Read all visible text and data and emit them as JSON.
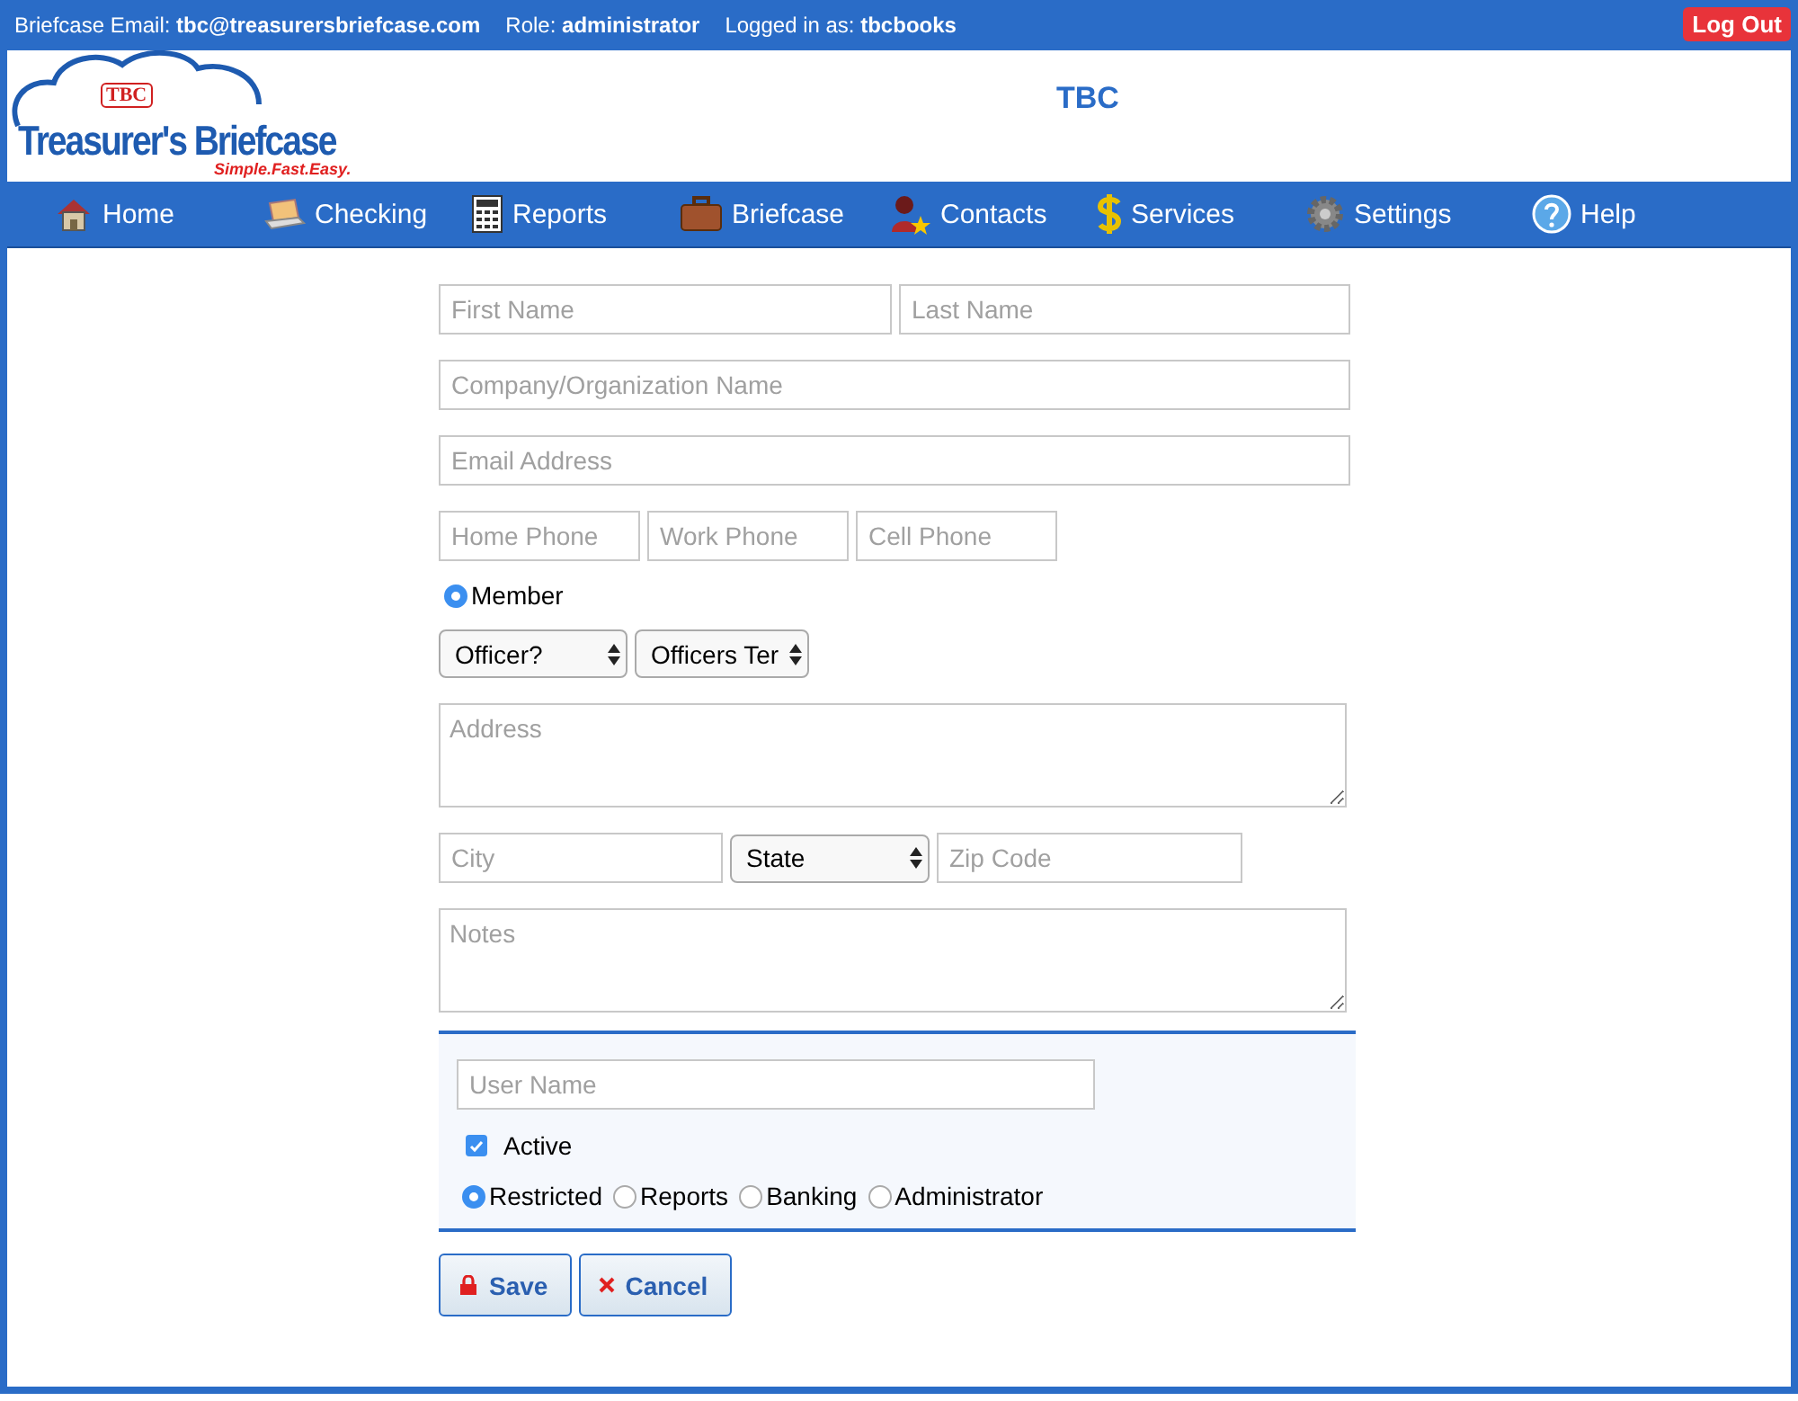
{
  "top_bar": {
    "items": [
      "Briefcase Email: **tbc@treasurersbriefcase.com**",
      "Role: **administrator**",
      "Logged in as: **tbcbooks**"
    ],
    "logout": "Log Out"
  },
  "header": {
    "logo": {
      "badge": "TBC",
      "name": "Treasurer's Briefcase",
      "tagline": "Simple.Fast.Easy."
    },
    "title": "TBC"
  },
  "nav": [
    {
      "label": "Home",
      "kind": "home"
    },
    {
      "label": "Checking",
      "kind": "checking"
    },
    {
      "label": "Reports",
      "kind": "reports"
    },
    {
      "label": "Briefcase",
      "kind": "briefcase"
    },
    {
      "label": "Contacts",
      "kind": "contacts"
    },
    {
      "label": "Services",
      "kind": "services"
    },
    {
      "label": "Settings",
      "kind": "settings"
    },
    {
      "label": "Help",
      "kind": "help"
    }
  ],
  "form": {
    "fields": [
      {
        "kind": "input",
        "placeholder": "First Name"
      },
      {
        "kind": "input",
        "placeholder": "Last Name"
      },
      {
        "kind": "input",
        "placeholder": "Company/Organization Name"
      },
      {
        "kind": "input",
        "placeholder": "Email Address"
      },
      {
        "kind": "input",
        "placeholder": "Home Phone"
      },
      {
        "kind": "input",
        "placeholder": "Work Phone"
      },
      {
        "kind": "input",
        "placeholder": "Cell Phone"
      },
      {
        "kind": "radio",
        "label": "Member",
        "selected": true
      },
      {
        "kind": "select",
        "value": "Officer?"
      },
      {
        "kind": "select",
        "value": "Officers Ter"
      },
      {
        "kind": "textarea",
        "placeholder": "Address"
      },
      {
        "kind": "input",
        "placeholder": "City"
      },
      {
        "kind": "select",
        "value": "State"
      },
      {
        "kind": "input",
        "placeholder": "Zip Code"
      },
      {
        "kind": "textarea",
        "placeholder": "Notes"
      }
    ],
    "user": {
      "username": {
        "placeholder": "User Name"
      },
      "active": {
        "label": "Active",
        "checked": true
      },
      "roles": [
        {
          "label": "Restricted",
          "selected": true
        },
        {
          "label": "Reports",
          "selected": false
        },
        {
          "label": "Banking",
          "selected": false
        },
        {
          "label": "Administrator",
          "selected": false
        }
      ]
    },
    "buttons": [
      {
        "label": "Save",
        "kind": "save"
      },
      {
        "label": "Cancel",
        "kind": "cancel"
      }
    ]
  }
}
